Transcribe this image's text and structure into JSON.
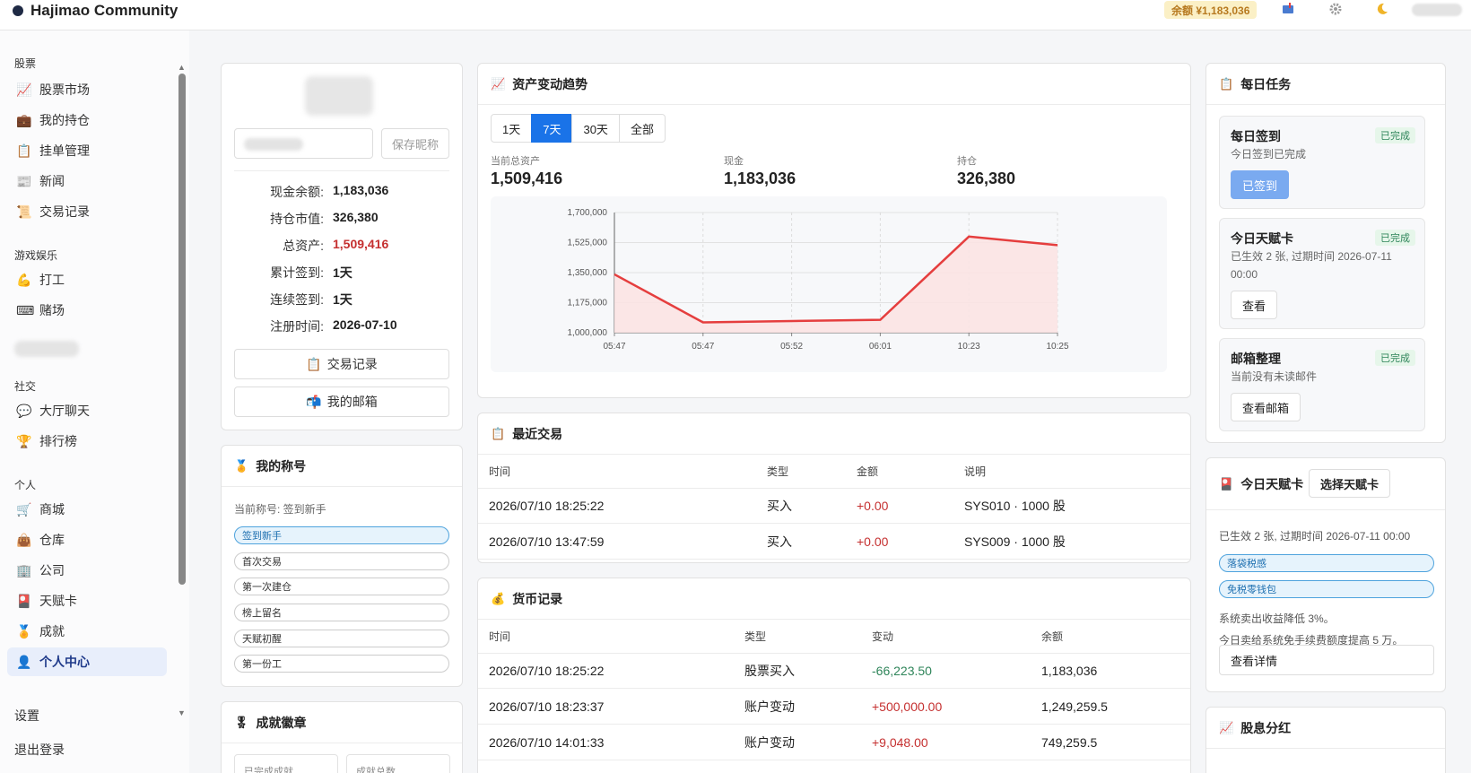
{
  "header": {
    "brand": "Hajimao Community",
    "balance": "余额 ¥1,183,036"
  },
  "sidebar": {
    "groups": [
      {
        "label": "股票",
        "items": [
          {
            "label": "股票市场",
            "icon": "chart-icon"
          },
          {
            "label": "我的持仓",
            "icon": "briefcase-icon"
          },
          {
            "label": "挂单管理",
            "icon": "clipboard-icon"
          },
          {
            "label": "新闻",
            "icon": "newspaper-icon"
          },
          {
            "label": "交易记录",
            "icon": "scroll-icon"
          }
        ]
      },
      {
        "label": "游戏娱乐",
        "items": [
          {
            "label": "打工",
            "icon": "muscle-icon"
          },
          {
            "label": "赌场",
            "icon": "keyboard-icon"
          }
        ]
      },
      {
        "label": "社交",
        "items": [
          {
            "label": "大厅聊天",
            "icon": "chat-icon"
          },
          {
            "label": "排行榜",
            "icon": "trophy-icon"
          }
        ]
      },
      {
        "label": "个人",
        "items": [
          {
            "label": "商城",
            "icon": "cart-icon"
          },
          {
            "label": "仓库",
            "icon": "bag-icon"
          },
          {
            "label": "公司",
            "icon": "building-icon"
          },
          {
            "label": "天赋卡",
            "icon": "card-icon"
          },
          {
            "label": "成就",
            "icon": "medal-icon"
          },
          {
            "label": "个人中心",
            "icon": "user-icon"
          }
        ]
      }
    ],
    "settings": "设置",
    "logout": "退出登录"
  },
  "profile": {
    "save_nick": "保存昵称",
    "stats": [
      {
        "label": "现金余额:",
        "value": "1,183,036"
      },
      {
        "label": "持仓市值:",
        "value": "326,380"
      },
      {
        "label": "总资产:",
        "value": "1,509,416"
      },
      {
        "label": "累计签到:",
        "value": "1天"
      },
      {
        "label": "连续签到:",
        "value": "1天"
      },
      {
        "label": "注册时间:",
        "value": "2026-07-10"
      }
    ],
    "trade_btn": "交易记录",
    "mail_btn": "我的邮箱"
  },
  "titles": {
    "heading": "我的称号",
    "current": "当前称号: 签到新手",
    "list": [
      "签到新手",
      "首次交易",
      "第一次建仓",
      "榜上留名",
      "天赋初醒",
      "第一份工"
    ]
  },
  "badges": {
    "heading": "成就徽章",
    "completed": "已完成成就",
    "total": "成就总数"
  },
  "trend": {
    "heading": "资产变动趋势",
    "ranges": [
      "1天",
      "7天",
      "30天",
      "全部"
    ],
    "active_range": "7天",
    "metrics": [
      {
        "label": "当前总资产",
        "value": "1,509,416"
      },
      {
        "label": "现金",
        "value": "1,183,036"
      },
      {
        "label": "持仓",
        "value": "326,380"
      }
    ]
  },
  "chart_data": {
    "type": "area",
    "x": [
      "05:47",
      "05:47",
      "05:52",
      "06:01",
      "10:23",
      "10:25"
    ],
    "values": [
      1340000,
      1060000,
      1068000,
      1075000,
      1560000,
      1510000
    ],
    "ylim": [
      1000000,
      1700000
    ],
    "yticks": [
      "1,000,000",
      "1,175,000",
      "1,350,000",
      "1,525,000",
      "1,700,000"
    ],
    "grid": true,
    "line_color": "#e53e3e",
    "fill_color": "#fbe3e3"
  },
  "recent": {
    "heading": "最近交易",
    "columns": [
      "时间",
      "类型",
      "金额",
      "说明"
    ],
    "rows": [
      {
        "time": "2026/07/10 18:25:22",
        "type": "买入",
        "amount": "+0.00",
        "desc": "SYS010 · 1000 股"
      },
      {
        "time": "2026/07/10 13:47:59",
        "type": "买入",
        "amount": "+0.00",
        "desc": "SYS009 · 1000 股"
      }
    ]
  },
  "currency": {
    "heading": "货币记录",
    "columns": [
      "时间",
      "类型",
      "变动",
      "余额"
    ],
    "rows": [
      {
        "time": "2026/07/10 18:25:22",
        "type": "股票买入",
        "change": "-66,223.50",
        "balance": "1,183,036"
      },
      {
        "time": "2026/07/10 18:23:37",
        "type": "账户变动",
        "change": "+500,000.00",
        "balance": "1,249,259.5"
      },
      {
        "time": "2026/07/10 14:01:33",
        "type": "账户变动",
        "change": "+9,048.00",
        "balance": "749,259.5"
      }
    ]
  },
  "tasks": {
    "heading": "每日任务",
    "items": [
      {
        "title": "每日签到",
        "status": "已完成",
        "desc": "今日签到已完成",
        "button": "已签到"
      },
      {
        "title": "今日天赋卡",
        "status": "已完成",
        "desc": "已生效 2 张, 过期时间 2026-07-11 00:00",
        "button": "查看"
      },
      {
        "title": "邮箱整理",
        "status": "已完成",
        "desc": "当前没有未读邮件",
        "button": "查看邮箱"
      }
    ]
  },
  "talent": {
    "heading": "今日天赋卡",
    "select": "选择天赋卡",
    "info": "已生效 2 张, 过期时间 2026-07-11 00:00",
    "cards": [
      "落袋税感",
      "免税零钱包"
    ],
    "effect1": "系统卖出收益降低 3%。",
    "effect2": "今日卖给系统免手续费额度提高 5 万。",
    "detail": "查看详情"
  },
  "dividend": {
    "heading": "股息分红"
  }
}
